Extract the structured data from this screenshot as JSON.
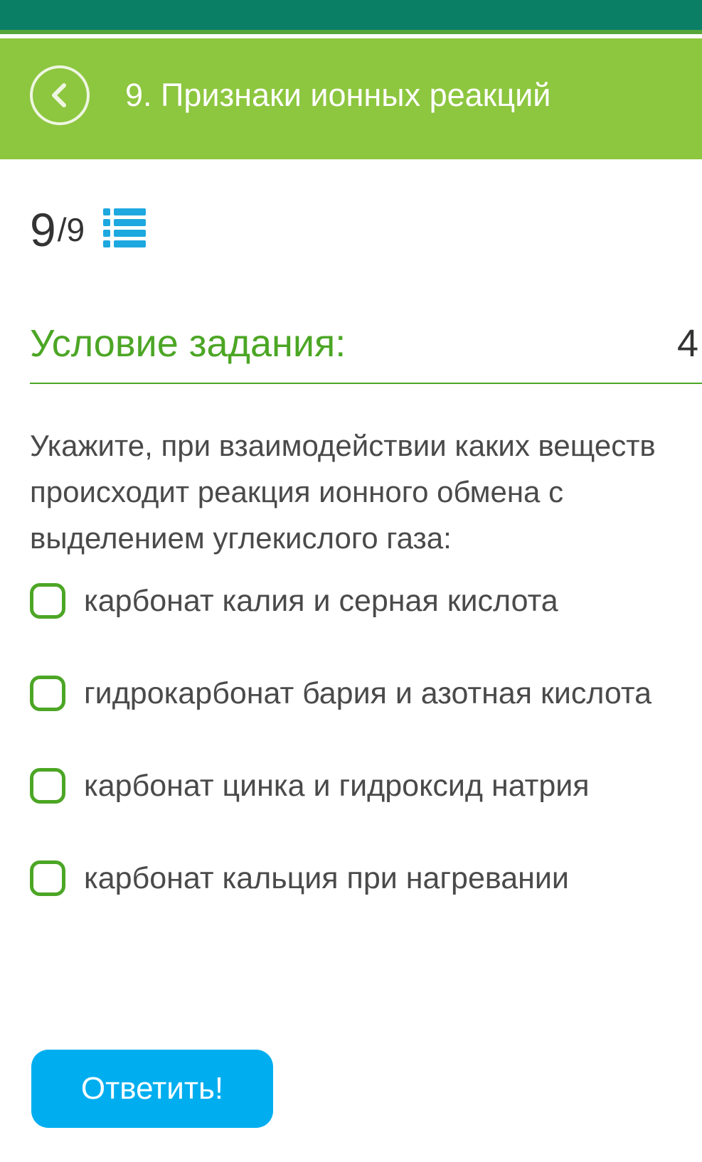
{
  "header": {
    "title": "9. Признаки ионных реакций",
    "back_icon": "chevron-left-icon",
    "color": "#8dc63f"
  },
  "progress": {
    "current": "9",
    "separator": "/",
    "total": "9",
    "list_icon": "list-icon",
    "list_icon_color": "#1ea8e0"
  },
  "condition": {
    "title": "Условие задания:",
    "points": "4",
    "accent_color": "#4ca625"
  },
  "question": {
    "text": "Укажите, при взаимодействии каких веществ происходит реакция ионного обмена с выделением углекислого газа:"
  },
  "options": [
    {
      "label": "карбонат калия и серная кислота",
      "checked": false
    },
    {
      "label": "гидрокарбонат бария и азотная кислота",
      "checked": false
    },
    {
      "label": "карбонат цинка и гидроксид натрия",
      "checked": false
    },
    {
      "label": "карбонат кальция при нагревании",
      "checked": false
    }
  ],
  "submit": {
    "label": "Ответить!",
    "color": "#00aeef"
  }
}
